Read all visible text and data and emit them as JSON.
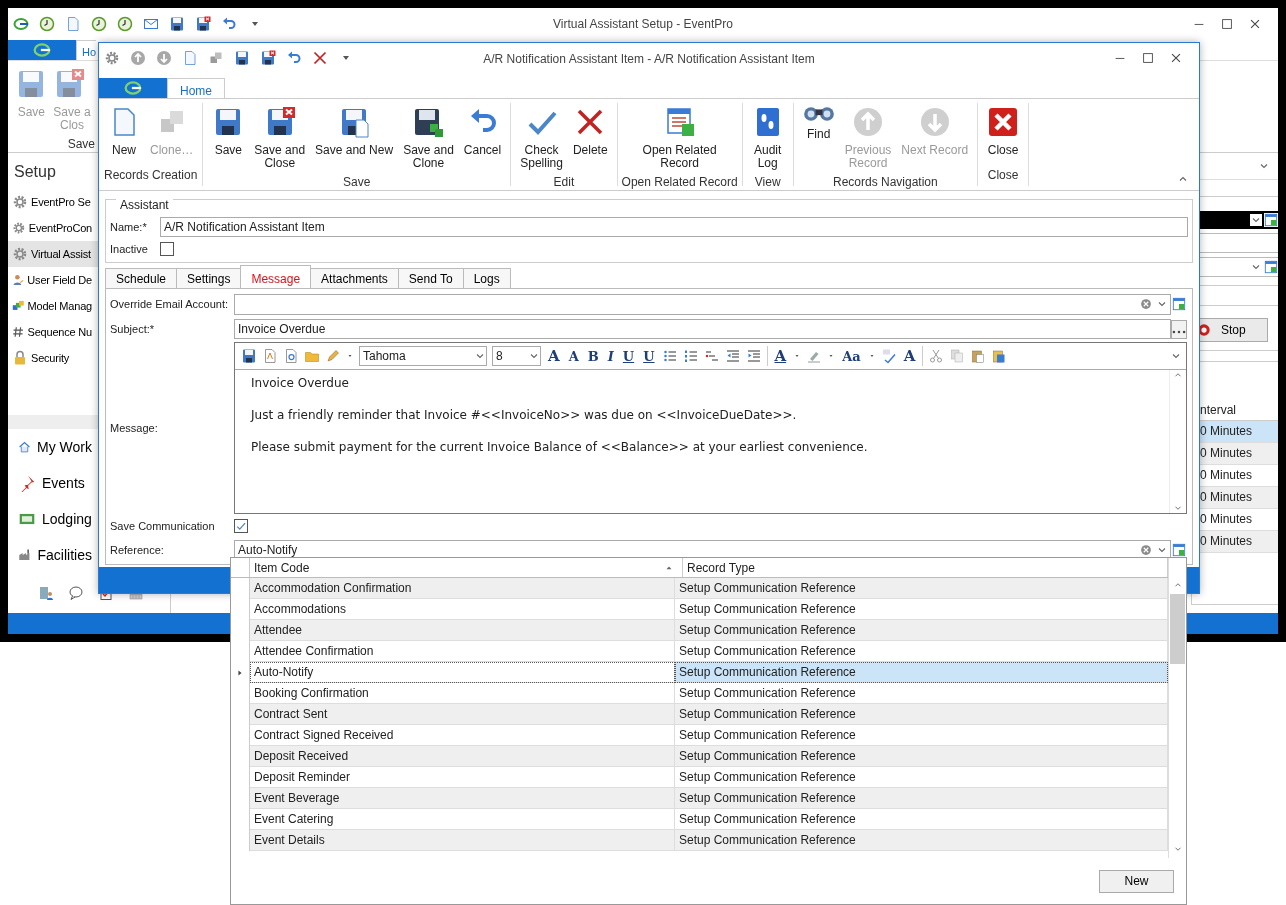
{
  "background_window": {
    "title": "Virtual Assistant Setup - EventPro",
    "ribbon_tab": {
      "label": "Ho",
      "selected": true
    },
    "ribbon_buttons": [
      {
        "label": "Save",
        "disabled": true
      },
      {
        "label": "Save a\nClos",
        "disabled": true
      }
    ],
    "ribbon_group": "Save",
    "sidebar": {
      "title": "Setup",
      "items": [
        {
          "label": "EventPro Se",
          "selected": false
        },
        {
          "label": "EventProCon",
          "selected": false
        },
        {
          "label": "Virtual Assist",
          "selected": true
        },
        {
          "label": "User Field De",
          "selected": false
        },
        {
          "label": "Model Manag",
          "selected": false
        },
        {
          "label": "Sequence Nu",
          "selected": false
        },
        {
          "label": "Security",
          "selected": false
        }
      ]
    },
    "nav": [
      "My Work",
      "Events",
      "Lodging",
      "Facilities"
    ],
    "stop_button": "Stop",
    "grid": {
      "header": "nterval",
      "rows": [
        {
          "text": "0 Minutes",
          "selected": true
        },
        {
          "text": "0 Minutes",
          "selected": false
        },
        {
          "text": "0 Minutes",
          "selected": false
        },
        {
          "text": "0 Minutes",
          "selected": false
        },
        {
          "text": "0 Minutes",
          "selected": false
        },
        {
          "text": "0 Minutes",
          "selected": false
        }
      ]
    }
  },
  "dialog": {
    "title": "A/R Notification Assistant Item - A/R Notification Assistant Item",
    "ribbon_tab": {
      "label": "Home",
      "selected": true
    },
    "ribbon_groups": [
      {
        "label": "Records Creation",
        "buttons": [
          {
            "label": "New",
            "disabled": false
          },
          {
            "label": "Clone…",
            "disabled": true
          }
        ]
      },
      {
        "label": "Save",
        "buttons": [
          {
            "label": "Save",
            "disabled": false
          },
          {
            "label": "Save and\nClose",
            "disabled": false
          },
          {
            "label": "Save and New",
            "disabled": false
          },
          {
            "label": "Save and\nClone",
            "disabled": false
          },
          {
            "label": "Cancel",
            "disabled": false
          }
        ]
      },
      {
        "label": "Edit",
        "buttons": [
          {
            "label": "Check\nSpelling",
            "disabled": false
          },
          {
            "label": "Delete",
            "disabled": false
          }
        ]
      },
      {
        "label": "Open Related Record",
        "buttons": [
          {
            "label": "Open Related\nRecord",
            "disabled": false
          }
        ]
      },
      {
        "label": "View",
        "buttons": [
          {
            "label": "Audit\nLog",
            "disabled": false
          }
        ]
      },
      {
        "label": "Records Navigation",
        "buttons": [
          {
            "label": "Find",
            "disabled": false
          },
          {
            "label": "Previous\nRecord",
            "disabled": true
          },
          {
            "label": "Next Record",
            "disabled": true
          }
        ]
      },
      {
        "label": "Close",
        "buttons": [
          {
            "label": "Close",
            "disabled": false
          }
        ]
      }
    ],
    "assistant": {
      "legend": "Assistant",
      "name_label": "Name:*",
      "name": "A/R Notification Assistant Item",
      "inactive_label": "Inactive",
      "inactive": false
    },
    "tabs": [
      {
        "label": "Schedule",
        "selected": false
      },
      {
        "label": "Settings",
        "selected": false
      },
      {
        "label": "Message",
        "selected": true
      },
      {
        "label": "Attachments",
        "selected": false
      },
      {
        "label": "Send To",
        "selected": false
      },
      {
        "label": "Logs",
        "selected": false
      }
    ],
    "override_label": "Override Email Account:",
    "subject_label": "Subject:*",
    "subject": "Invoice  Overdue",
    "message_label": "Message:",
    "editor": {
      "font": "Tahoma",
      "size": "8",
      "glyphs": [
        "A",
        "A",
        "B",
        "I",
        "U",
        "U",
        "A",
        "Aa",
        "A"
      ],
      "paragraphs": [
        "Invoice Overdue",
        "Just a friendly reminder that Invoice #<<InvoiceNo>> was due on <<InvoiceDueDate>>.",
        "Please submit payment for the current Invoice Balance of <<Balance>> at your earliest convenience."
      ]
    },
    "save_communication_label": "Save Communication",
    "save_communication": true,
    "reference_label": "Reference:",
    "reference": "Auto-Notify"
  },
  "dropdown": {
    "columns": [
      "Item Code",
      "Record Type"
    ],
    "rows": [
      {
        "item_code": "Accommodation Confirmation",
        "record_type": "Setup Communication Reference",
        "selected": false
      },
      {
        "item_code": "Accommodations",
        "record_type": "Setup Communication Reference",
        "selected": false
      },
      {
        "item_code": "Attendee",
        "record_type": "Setup Communication Reference",
        "selected": false
      },
      {
        "item_code": "Attendee Confirmation",
        "record_type": "Setup Communication Reference",
        "selected": false
      },
      {
        "item_code": "Auto-Notify",
        "record_type": "Setup Communication Reference",
        "selected": true
      },
      {
        "item_code": "Booking Confirmation",
        "record_type": "Setup Communication Reference",
        "selected": false
      },
      {
        "item_code": "Contract Sent",
        "record_type": "Setup Communication Reference",
        "selected": false
      },
      {
        "item_code": "Contract Signed Received",
        "record_type": "Setup Communication Reference",
        "selected": false
      },
      {
        "item_code": "Deposit Received",
        "record_type": "Setup Communication Reference",
        "selected": false
      },
      {
        "item_code": "Deposit Reminder",
        "record_type": "Setup Communication Reference",
        "selected": false
      },
      {
        "item_code": "Event Beverage",
        "record_type": "Setup Communication Reference",
        "selected": false
      },
      {
        "item_code": "Event Catering",
        "record_type": "Setup Communication Reference",
        "selected": false
      },
      {
        "item_code": "Event Details",
        "record_type": "Setup Communication Reference",
        "selected": false
      }
    ],
    "new_button": "New"
  }
}
